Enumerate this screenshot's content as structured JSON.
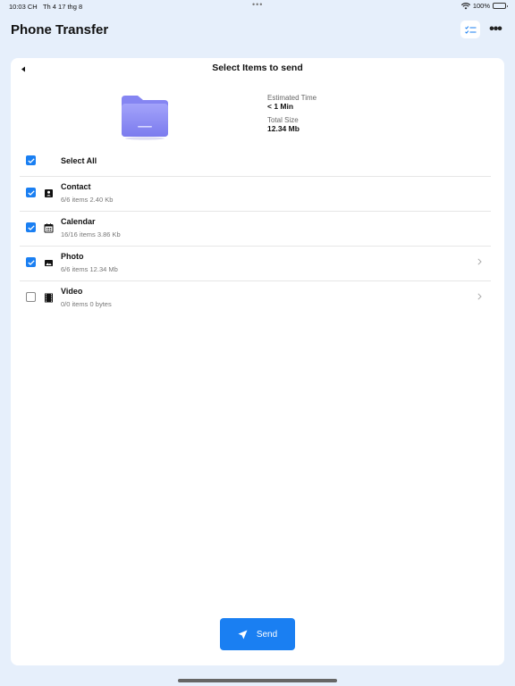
{
  "status": {
    "time": "10:03 CH",
    "date": "Th 4 17 thg 8",
    "dots": "•••",
    "battery": "100%"
  },
  "header": {
    "title": "Phone Transfer",
    "more_label": "•••"
  },
  "card": {
    "title": "Select Items to send",
    "estimated_time_label": "Estimated Time",
    "estimated_time_value": "< 1 Min",
    "total_size_label": "Total Size",
    "total_size_value": "12.34 Mb",
    "select_all_label": "Select All",
    "items": [
      {
        "name": "Contact",
        "sub": "6/6 items 2.40 Kb",
        "checked": true,
        "icon": "contact-icon",
        "chevron": false
      },
      {
        "name": "Calendar",
        "sub": "16/16 items 3.86 Kb",
        "checked": true,
        "icon": "calendar-icon",
        "chevron": false
      },
      {
        "name": "Photo",
        "sub": "6/6 items 12.34 Mb",
        "checked": true,
        "icon": "photo-icon",
        "chevron": true
      },
      {
        "name": "Video",
        "sub": "0/0 items 0 bytes",
        "checked": false,
        "icon": "video-icon",
        "chevron": true
      }
    ],
    "send_label": "Send"
  },
  "colors": {
    "accent": "#1a7ff2",
    "background": "#e6effb",
    "folder": "#8f8ff3"
  }
}
